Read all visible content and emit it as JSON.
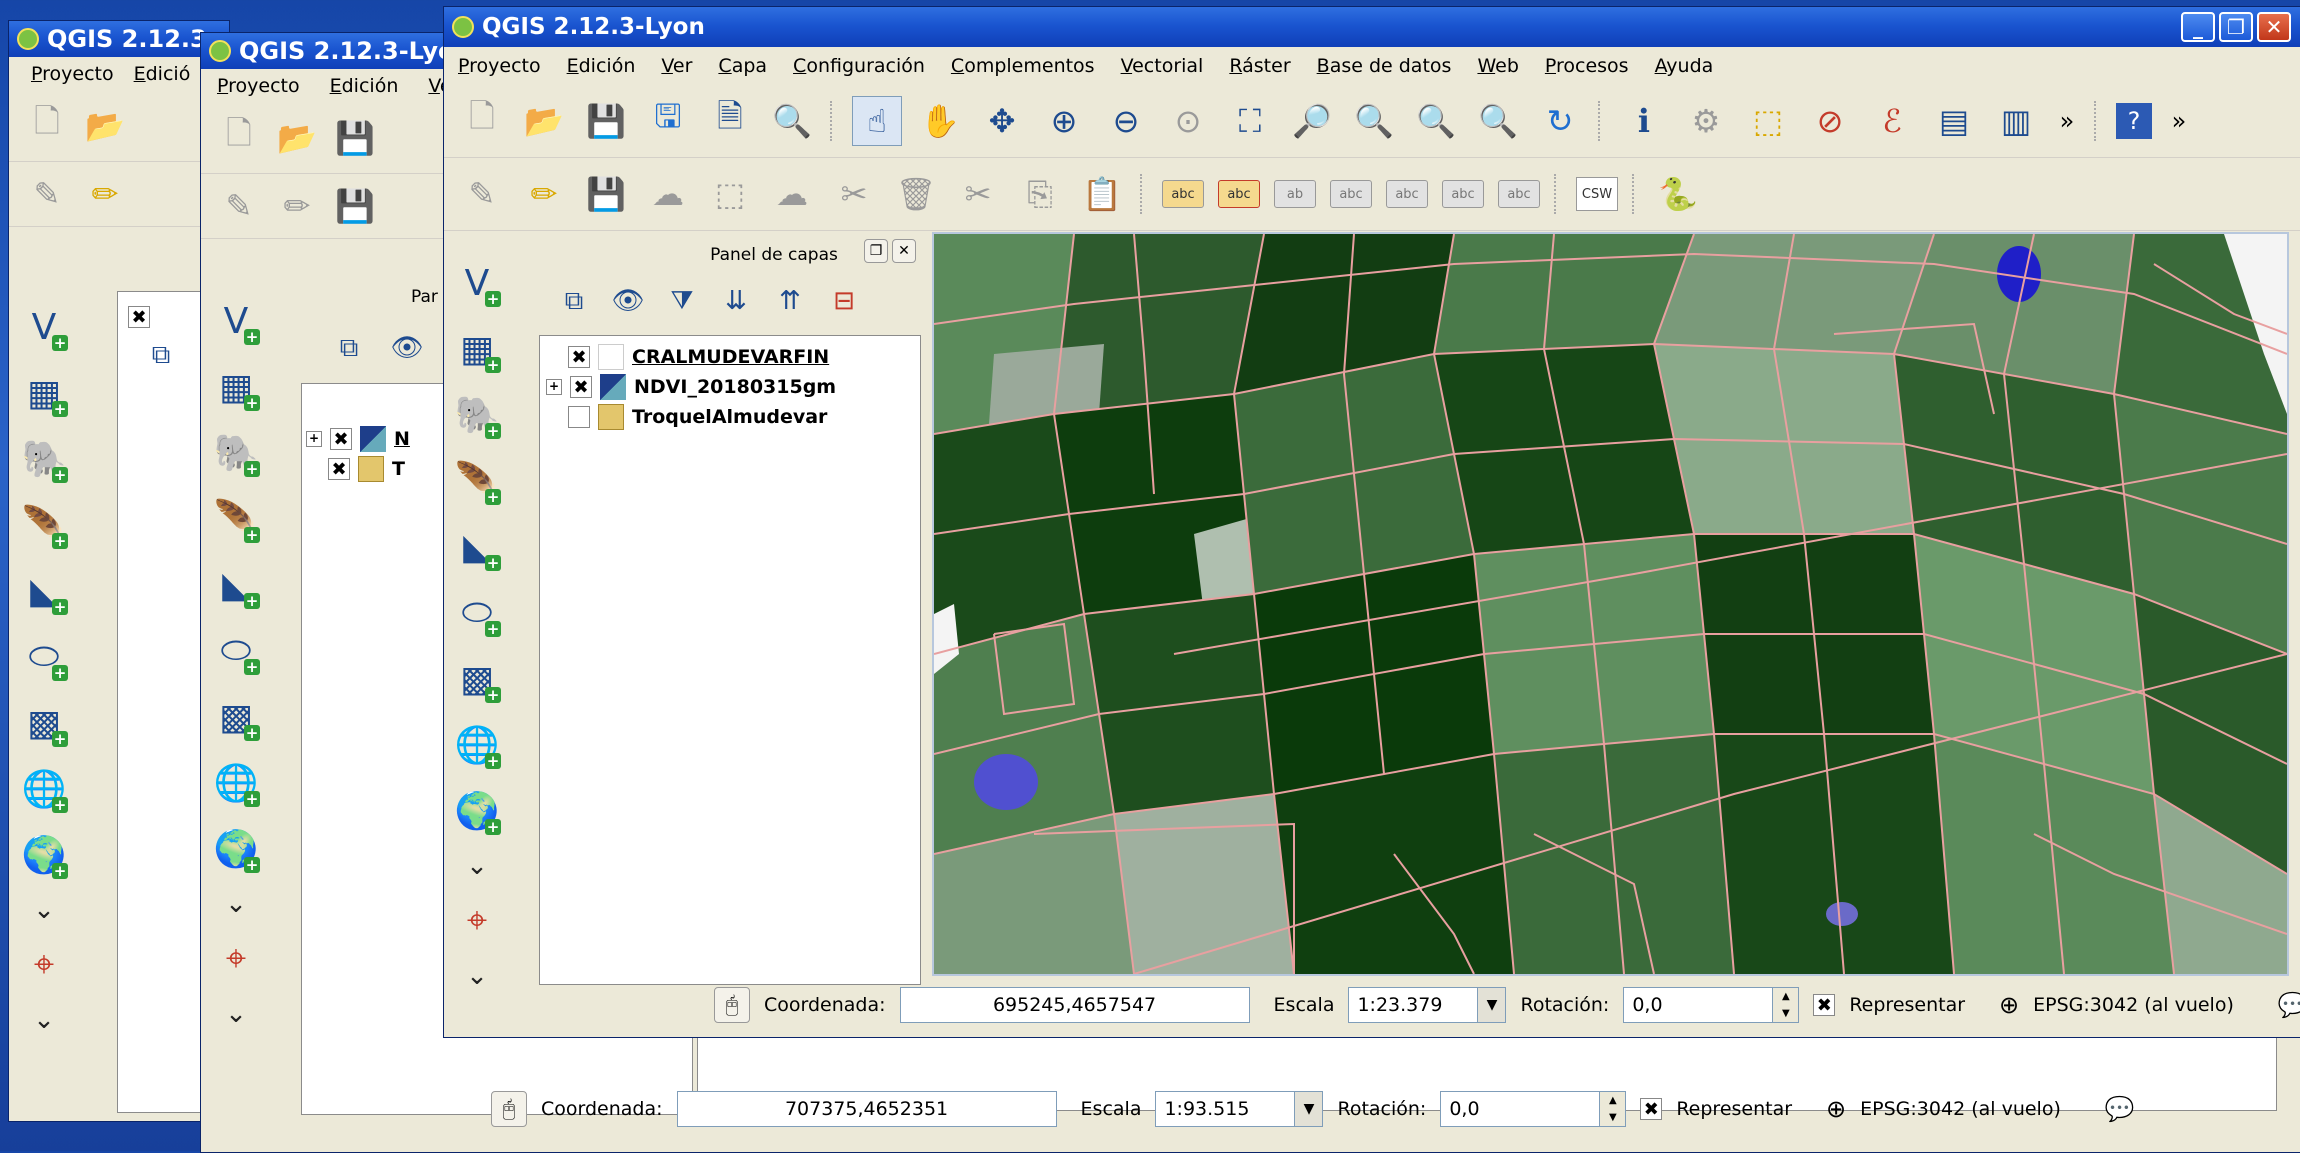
{
  "windows": {
    "back": {
      "title": "QGIS 2.12.3",
      "menu": [
        "Proyecto",
        "Edició"
      ]
    },
    "middle": {
      "title": "QGIS 2.12.3-Lyo",
      "menu": [
        "Proyecto",
        "Edición",
        "Ve"
      ],
      "layers_panel_title": "Par",
      "layers": [
        {
          "label": "N",
          "checked": "✖"
        },
        {
          "label": "T",
          "checked": "✖"
        }
      ],
      "status": {
        "coord_label": "Coordenada:",
        "coord_value": "707375,4652351",
        "scale_label": "Escala",
        "scale_value": "1:93.515",
        "rotation_label": "Rotación:",
        "rotation_value": "0,0",
        "render_label": "Representar",
        "render_check": "✖",
        "crs": "EPSG:3042 (al vuelo)"
      }
    },
    "front": {
      "title": "QGIS 2.12.3-Lyon",
      "menu": [
        "Proyecto",
        "Edición",
        "Ver",
        "Capa",
        "Configuración",
        "Complementos",
        "Vectorial",
        "Ráster",
        "Base de datos",
        "Web",
        "Procesos",
        "Ayuda"
      ],
      "layers_panel_title": "Panel de capas",
      "layers": [
        {
          "label": "CRALMUDEVARFIN",
          "checked": "✖"
        },
        {
          "label": "NDVI_20180315gm",
          "checked": "✖"
        },
        {
          "label": "TroquelAlmudevar",
          "checked": ""
        }
      ],
      "label_buttons": [
        "abc",
        "abc",
        "ab",
        "abc",
        "abc",
        "abc",
        "abc"
      ],
      "csw_label": "CSW",
      "overflow": "»",
      "status": {
        "coord_label": "Coordenada:",
        "coord_value": "695245,4657547",
        "scale_label": "Escala",
        "scale_value": "1:23.379",
        "rotation_label": "Rotación:",
        "rotation_value": "0,0",
        "render_label": "Representar",
        "render_check": "✖",
        "crs": "EPSG:3042 (al vuelo)"
      }
    }
  },
  "colors": {
    "titlebar": "#1a55d0",
    "field_lines": "#e8a0a0",
    "vegetation_dark": "#0d3d0d",
    "water": "#2a2ad0"
  }
}
